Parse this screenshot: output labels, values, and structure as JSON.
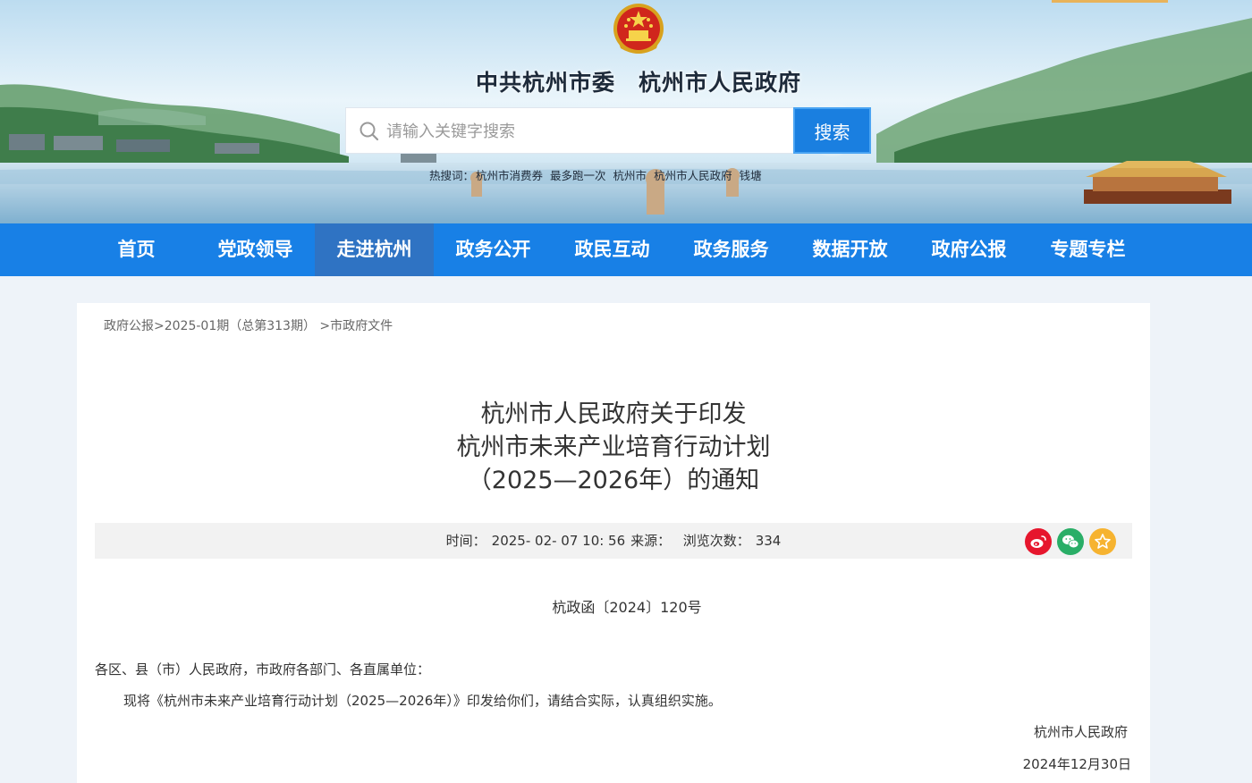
{
  "header": {
    "site_title": "中共杭州市委　杭州市人民政府",
    "emblem_icon": "national-emblem-icon",
    "search": {
      "placeholder": "请输入关键字搜索",
      "button_label": "搜索"
    },
    "hot_words": [
      "热搜词：",
      "杭州市消费券",
      "最多跑一次",
      "杭州市",
      "杭州市人民政府",
      "钱塘"
    ]
  },
  "nav": {
    "items": [
      {
        "label": "首页"
      },
      {
        "label": "党政领导"
      },
      {
        "label": "走进杭州"
      },
      {
        "label": "政务公开"
      },
      {
        "label": "政民互动"
      },
      {
        "label": "政务服务"
      },
      {
        "label": "数据开放"
      },
      {
        "label": "政府公报"
      },
      {
        "label": "专题专栏"
      }
    ],
    "active_index": 2
  },
  "breadcrumb": {
    "items": [
      "政府公报",
      "2025-01期（总第313期）",
      "市政府文件"
    ],
    "separator": ">"
  },
  "article": {
    "title_lines": [
      "杭州市人民政府关于印发",
      "杭州市未来产业培育行动计划",
      "（2025—2026年）的通知"
    ],
    "meta": {
      "time_label": "时间：",
      "time_value": "2025- 02- 07 10: 56",
      "source_label": "来源：",
      "views_label": "浏览次数：",
      "views_value": "334"
    },
    "share_icons": [
      {
        "name": "weibo-icon",
        "color": "#e6162d"
      },
      {
        "name": "wechat-icon",
        "color": "#2aae67"
      },
      {
        "name": "favorite-icon",
        "color": "#f6b330"
      }
    ],
    "doc_number": "杭政函〔2024〕120号",
    "addressee": "各区、县（市）人民政府，市政府各部门、各直属单位：",
    "body": "现将《杭州市未来产业培育行动计划（2025—2026年）》印发给你们，请结合实际，认真组织实施。",
    "signature_org": "杭州市人民政府",
    "signature_date": "2024年12月30日"
  },
  "colors": {
    "nav_bg": "#1880e6",
    "nav_active": "#2f73c3",
    "search_button": "#1a7fe0",
    "page_bg": "#eef3f9"
  }
}
